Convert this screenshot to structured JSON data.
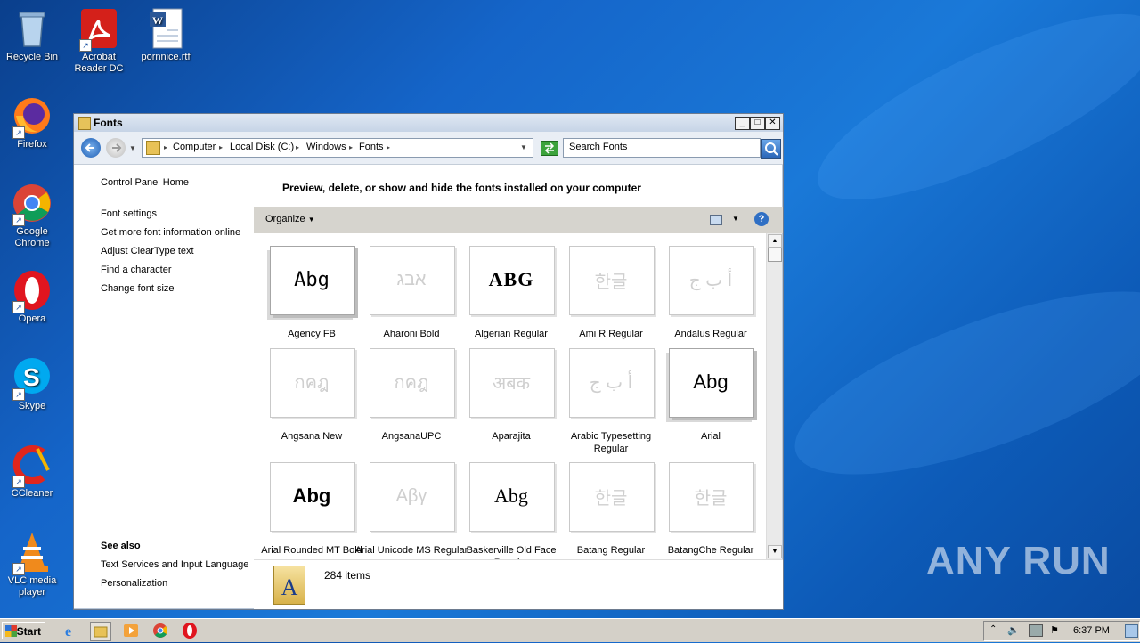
{
  "desktop": {
    "icons": [
      {
        "label": "Recycle Bin"
      },
      {
        "label": "Acrobat Reader DC"
      },
      {
        "label": "pornnice.rtf"
      },
      {
        "label": "Firefox"
      },
      {
        "label": "Google Chrome"
      },
      {
        "label": "Opera"
      },
      {
        "label": "Skype"
      },
      {
        "label": "CCleaner"
      },
      {
        "label": "VLC media player"
      }
    ],
    "watermark": "ANY RUN"
  },
  "window": {
    "title": "Fonts",
    "controls": {
      "minimize": "_",
      "maximize": "□",
      "close": "✕"
    },
    "address": {
      "crumbs": [
        "Computer",
        "Local Disk (C:)",
        "Windows",
        "Fonts"
      ],
      "separator": "▸"
    },
    "search": {
      "placeholder": "Search Fonts"
    },
    "left_nav": {
      "home": "Control Panel Home",
      "links": [
        "Font settings",
        "Get more font information online",
        "Adjust ClearType text",
        "Find a character",
        "Change font size"
      ],
      "see_also_heading": "See also",
      "see_also": [
        "Text Services and Input Language",
        "Personalization"
      ]
    },
    "heading": "Preview, delete, or show and hide the fonts installed on your computer",
    "toolbar": {
      "organize": "Organize"
    },
    "fonts": [
      {
        "name": "Agency FB",
        "preview": "Abg",
        "hidden": false,
        "family": true
      },
      {
        "name": "Aharoni Bold",
        "preview": "אבג",
        "hidden": true,
        "family": false
      },
      {
        "name": "Algerian Regular",
        "preview": "ABG",
        "hidden": false,
        "family": false
      },
      {
        "name": "Ami R Regular",
        "preview": "한글",
        "hidden": true,
        "family": false
      },
      {
        "name": "Andalus Regular",
        "preview": "أ ب ج",
        "hidden": true,
        "family": false
      },
      {
        "name": "Angsana New",
        "preview": "กคฎ",
        "hidden": true,
        "family": true
      },
      {
        "name": "AngsanaUPC",
        "preview": "กคฎ",
        "hidden": true,
        "family": true
      },
      {
        "name": "Aparajita",
        "preview": "अबक",
        "hidden": true,
        "family": true
      },
      {
        "name": "Arabic Typesetting Regular",
        "preview": "أ ب ج",
        "hidden": true,
        "family": false
      },
      {
        "name": "Arial",
        "preview": "Abg",
        "hidden": false,
        "family": true
      },
      {
        "name": "Arial Rounded MT Bold",
        "preview": "Abg",
        "hidden": false,
        "family": false
      },
      {
        "name": "Arial Unicode MS Regular",
        "preview": "Αβγ",
        "hidden": true,
        "family": false
      },
      {
        "name": "Baskerville Old Face Regular",
        "preview": "Abg",
        "hidden": false,
        "family": false
      },
      {
        "name": "Batang Regular",
        "preview": "한글",
        "hidden": true,
        "family": false
      },
      {
        "name": "BatangChe Regular",
        "preview": "한글",
        "hidden": true,
        "family": false
      }
    ],
    "status": {
      "count": "284 items",
      "icon_letter": "A"
    }
  },
  "taskbar": {
    "start": "Start",
    "clock": "6:37 PM"
  }
}
